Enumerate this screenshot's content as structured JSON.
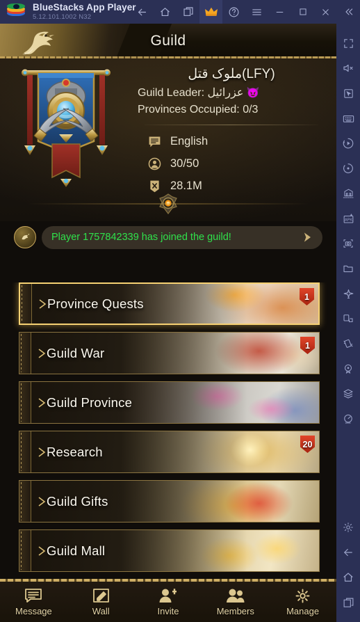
{
  "bluestacks": {
    "app_title": "BlueStacks App Player",
    "version": "5.12.101.1002  N32",
    "logo_icon": "bluestacks-logo",
    "window_buttons": [
      {
        "name": "back-button",
        "icon": "arrow-left-icon",
        "active": false
      },
      {
        "name": "home-button",
        "icon": "home-icon",
        "active": false
      },
      {
        "name": "multi-window-button",
        "icon": "windows-icon",
        "active": false
      },
      {
        "name": "premium-button",
        "icon": "crown-icon",
        "active": true
      },
      {
        "name": "help-button",
        "icon": "question-circle-icon",
        "active": false
      },
      {
        "name": "menu-button",
        "icon": "hamburger-icon",
        "active": false
      },
      {
        "name": "minimize-button",
        "icon": "minimize-icon",
        "active": false
      },
      {
        "name": "maximize-button",
        "icon": "maximize-icon",
        "active": false
      },
      {
        "name": "close-button",
        "icon": "close-icon",
        "active": false
      },
      {
        "name": "collapse-sidebar-button",
        "icon": "chevrons-left-icon",
        "active": false
      }
    ],
    "sidebar_icons": [
      "fullscreen-icon",
      "mute-icon",
      "pointer-icon",
      "keyboard-controls-icon",
      "macro-recorder-icon",
      "rotate-icon",
      "multi-instance-icon",
      "install-apk-icon",
      "screenshot-icon",
      "media-manager-icon",
      "eco-mode-icon",
      "screen-resize-icon",
      "shake-icon",
      "location-icon",
      "layers-icon",
      "performance-icon"
    ],
    "sidebar_bottom_icons": [
      "settings-gear-icon",
      "android-back-icon",
      "android-home-icon",
      "android-recents-icon"
    ]
  },
  "game": {
    "header": {
      "title": "Guild",
      "crest_icon": "eagle-crest-icon"
    },
    "guild": {
      "banner_icon": "guild-banner-emblem",
      "name": "ملوک قتل(LFY)",
      "leader_label": "Guild Leader:",
      "leader_name": "عزرائيل",
      "leader_emoji": "😈",
      "provinces_label": "Provinces Occupied:",
      "provinces_value": "0/3",
      "stats": [
        {
          "icon": "language-icon",
          "value": "English"
        },
        {
          "icon": "members-icon",
          "value": "30/50"
        },
        {
          "icon": "power-shield-icon",
          "value": "28.1M"
        }
      ],
      "divider_icon": "guild-ornament-icon"
    },
    "announcement": {
      "avatar_icon": "guild-notice-avatar-icon",
      "text": "Player 1757842339 has joined the guild!",
      "send_icon": "send-arrow-icon",
      "text_color": "#2fe14b"
    },
    "menu_rows": [
      {
        "label": "Province Quests",
        "badge": "1",
        "selected": true,
        "art": "art-pq"
      },
      {
        "label": "Guild War",
        "badge": "1",
        "selected": false,
        "art": "art-gw"
      },
      {
        "label": "Guild Province",
        "badge": "",
        "selected": false,
        "art": "art-gp"
      },
      {
        "label": "Research",
        "badge": "20",
        "selected": false,
        "art": "art-rs"
      },
      {
        "label": "Guild Gifts",
        "badge": "",
        "selected": false,
        "art": "art-gg"
      },
      {
        "label": "Guild Mall",
        "badge": "",
        "selected": false,
        "art": "art-gm"
      },
      {
        "label": "",
        "badge": "",
        "selected": false,
        "art": "art-nx"
      }
    ],
    "bottom_tabs": [
      {
        "label": "Message",
        "icon": "message-icon"
      },
      {
        "label": "Wall",
        "icon": "wall-edit-icon"
      },
      {
        "label": "Invite",
        "icon": "invite-user-icon"
      },
      {
        "label": "Members",
        "icon": "members-group-icon"
      },
      {
        "label": "Manage",
        "icon": "manage-gear-icon"
      }
    ]
  },
  "colors": {
    "chrome_bg": "#2b3055",
    "gold": "#c8a75c",
    "badge_red": "#c9301a",
    "announce_green": "#2fe14b"
  }
}
